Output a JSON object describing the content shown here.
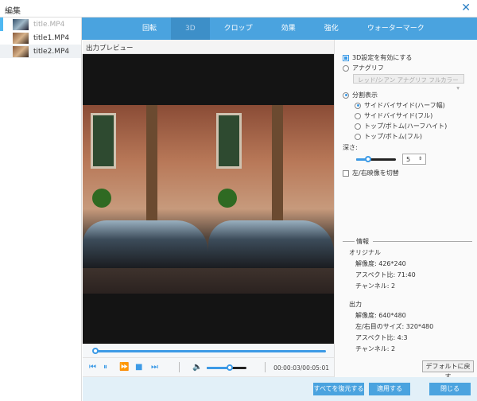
{
  "window": {
    "title": "編集"
  },
  "files": [
    "title.MP4",
    "title1.MP4",
    "title2.MP4"
  ],
  "tabs": [
    {
      "label": "回転"
    },
    {
      "label": "3D"
    },
    {
      "label": "クロップ"
    },
    {
      "label": "効果"
    },
    {
      "label": "強化"
    },
    {
      "label": "ウォーターマーク"
    }
  ],
  "active_tab": "3D",
  "preview": {
    "label": "出力プレビュー",
    "progress_percent": 1,
    "volume_percent": 60,
    "time": "00:00:03/00:05:01"
  },
  "settings": {
    "enable_3d": {
      "label": "3D設定を有効にする",
      "checked": true
    },
    "anaglyph": {
      "label": "アナグリフ",
      "selected": false
    },
    "anaglyph_option": "レッド/シアン アナグリフ フルカラー",
    "split": {
      "label": "分割表示",
      "selected": true
    },
    "split_options": [
      {
        "label": "サイドバイサイド(ハーフ幅)",
        "selected": true
      },
      {
        "label": "サイドバイサイド(フル)",
        "selected": false
      },
      {
        "label": "トップ/ボトム(ハーフハイト)",
        "selected": false
      },
      {
        "label": "トップ/ボトム(フル)",
        "selected": false
      }
    ],
    "depth_label": "深さ:",
    "depth_value": "5",
    "swap": {
      "label": "左/右映像を切替",
      "checked": false
    }
  },
  "info": {
    "header": "情報",
    "original_label": "オリジナル",
    "original": [
      "解像度: 426*240",
      "アスペクト比: 71:40",
      "チャンネル: 2"
    ],
    "output_label": "出力",
    "output": [
      "解像度: 640*480",
      "左/右目のサイズ: 320*480",
      "アスペクト比: 4:3",
      "チャンネル: 2"
    ]
  },
  "buttons": {
    "default": "デフォルトに戻す",
    "restore_all": "すべてを復元する",
    "apply": "適用する",
    "close": "閉じる"
  },
  "colors": {
    "accent": "#4aa3df"
  }
}
